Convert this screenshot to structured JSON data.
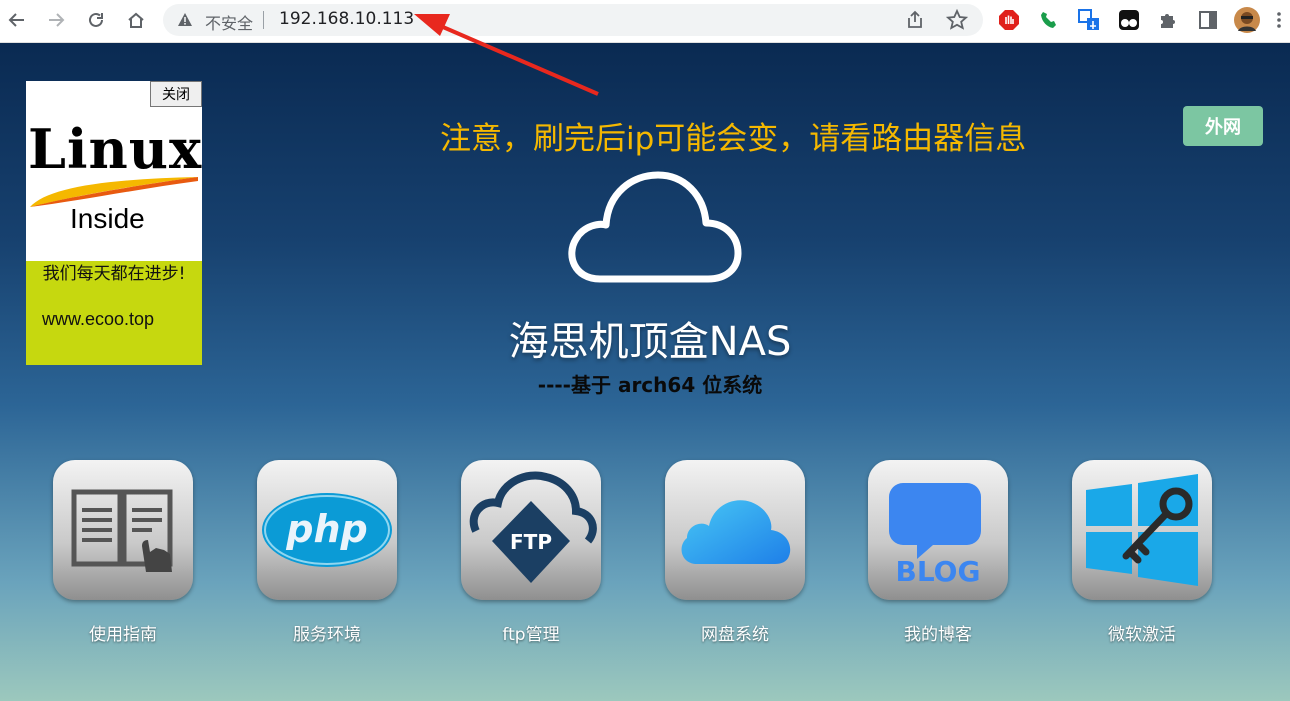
{
  "browser": {
    "security_label": "不安全",
    "url": "192.168.10.113"
  },
  "ad": {
    "close_label": "关闭",
    "logo_word": "Linux",
    "logo_sub": "Inside",
    "slogan": "我们每天都在进步!",
    "site": "www.ecoo.top"
  },
  "page": {
    "notice": "注意，刷完后ip可能会变，请看路由器信息",
    "external_button": "外网",
    "title": "海思机顶盒NAS",
    "subtitle": "----基于 arch64 位系统",
    "notice_color": "#f5b800",
    "external_button_color": "#7cc6a2"
  },
  "apps": [
    {
      "label": "使用指南",
      "icon": "book-hand-icon"
    },
    {
      "label": "服务环境",
      "icon": "php-icon",
      "icon_text": "php"
    },
    {
      "label": "ftp管理",
      "icon": "ftp-icon",
      "icon_text": "FTP"
    },
    {
      "label": "网盘系统",
      "icon": "icloud-icon"
    },
    {
      "label": "我的博客",
      "icon": "blog-icon",
      "icon_text": "BLOG"
    },
    {
      "label": "微软激活",
      "icon": "windows-key-icon"
    }
  ]
}
